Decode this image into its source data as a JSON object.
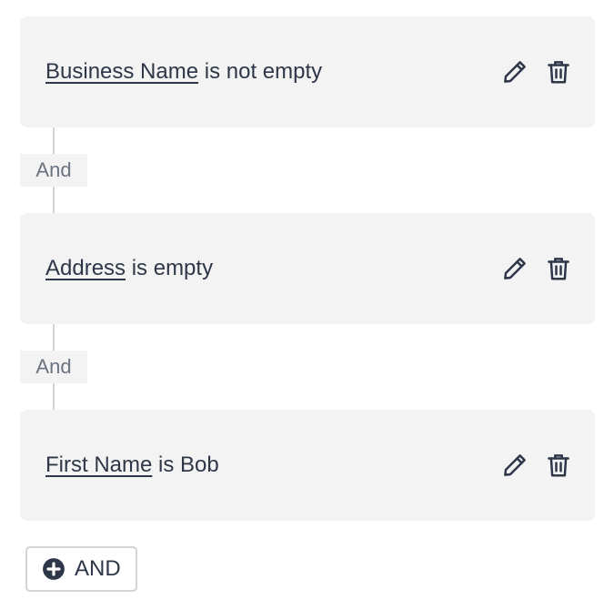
{
  "conditions": [
    {
      "field": "Business Name",
      "operator": " is not empty"
    },
    {
      "field": "Address",
      "operator": " is empty"
    },
    {
      "field": "First Name",
      "operator": " is Bob"
    }
  ],
  "connectors": [
    {
      "label": "And"
    },
    {
      "label": "And"
    }
  ],
  "actions": {
    "edit_icon": "pencil-icon",
    "delete_icon": "trash-icon"
  },
  "add_button": {
    "label": "AND",
    "icon": "plus-circle-icon"
  },
  "colors": {
    "card_background": "#f3f3f3",
    "text": "#2d3748",
    "connector_text": "#6b7280",
    "border": "#d4d4d4"
  }
}
